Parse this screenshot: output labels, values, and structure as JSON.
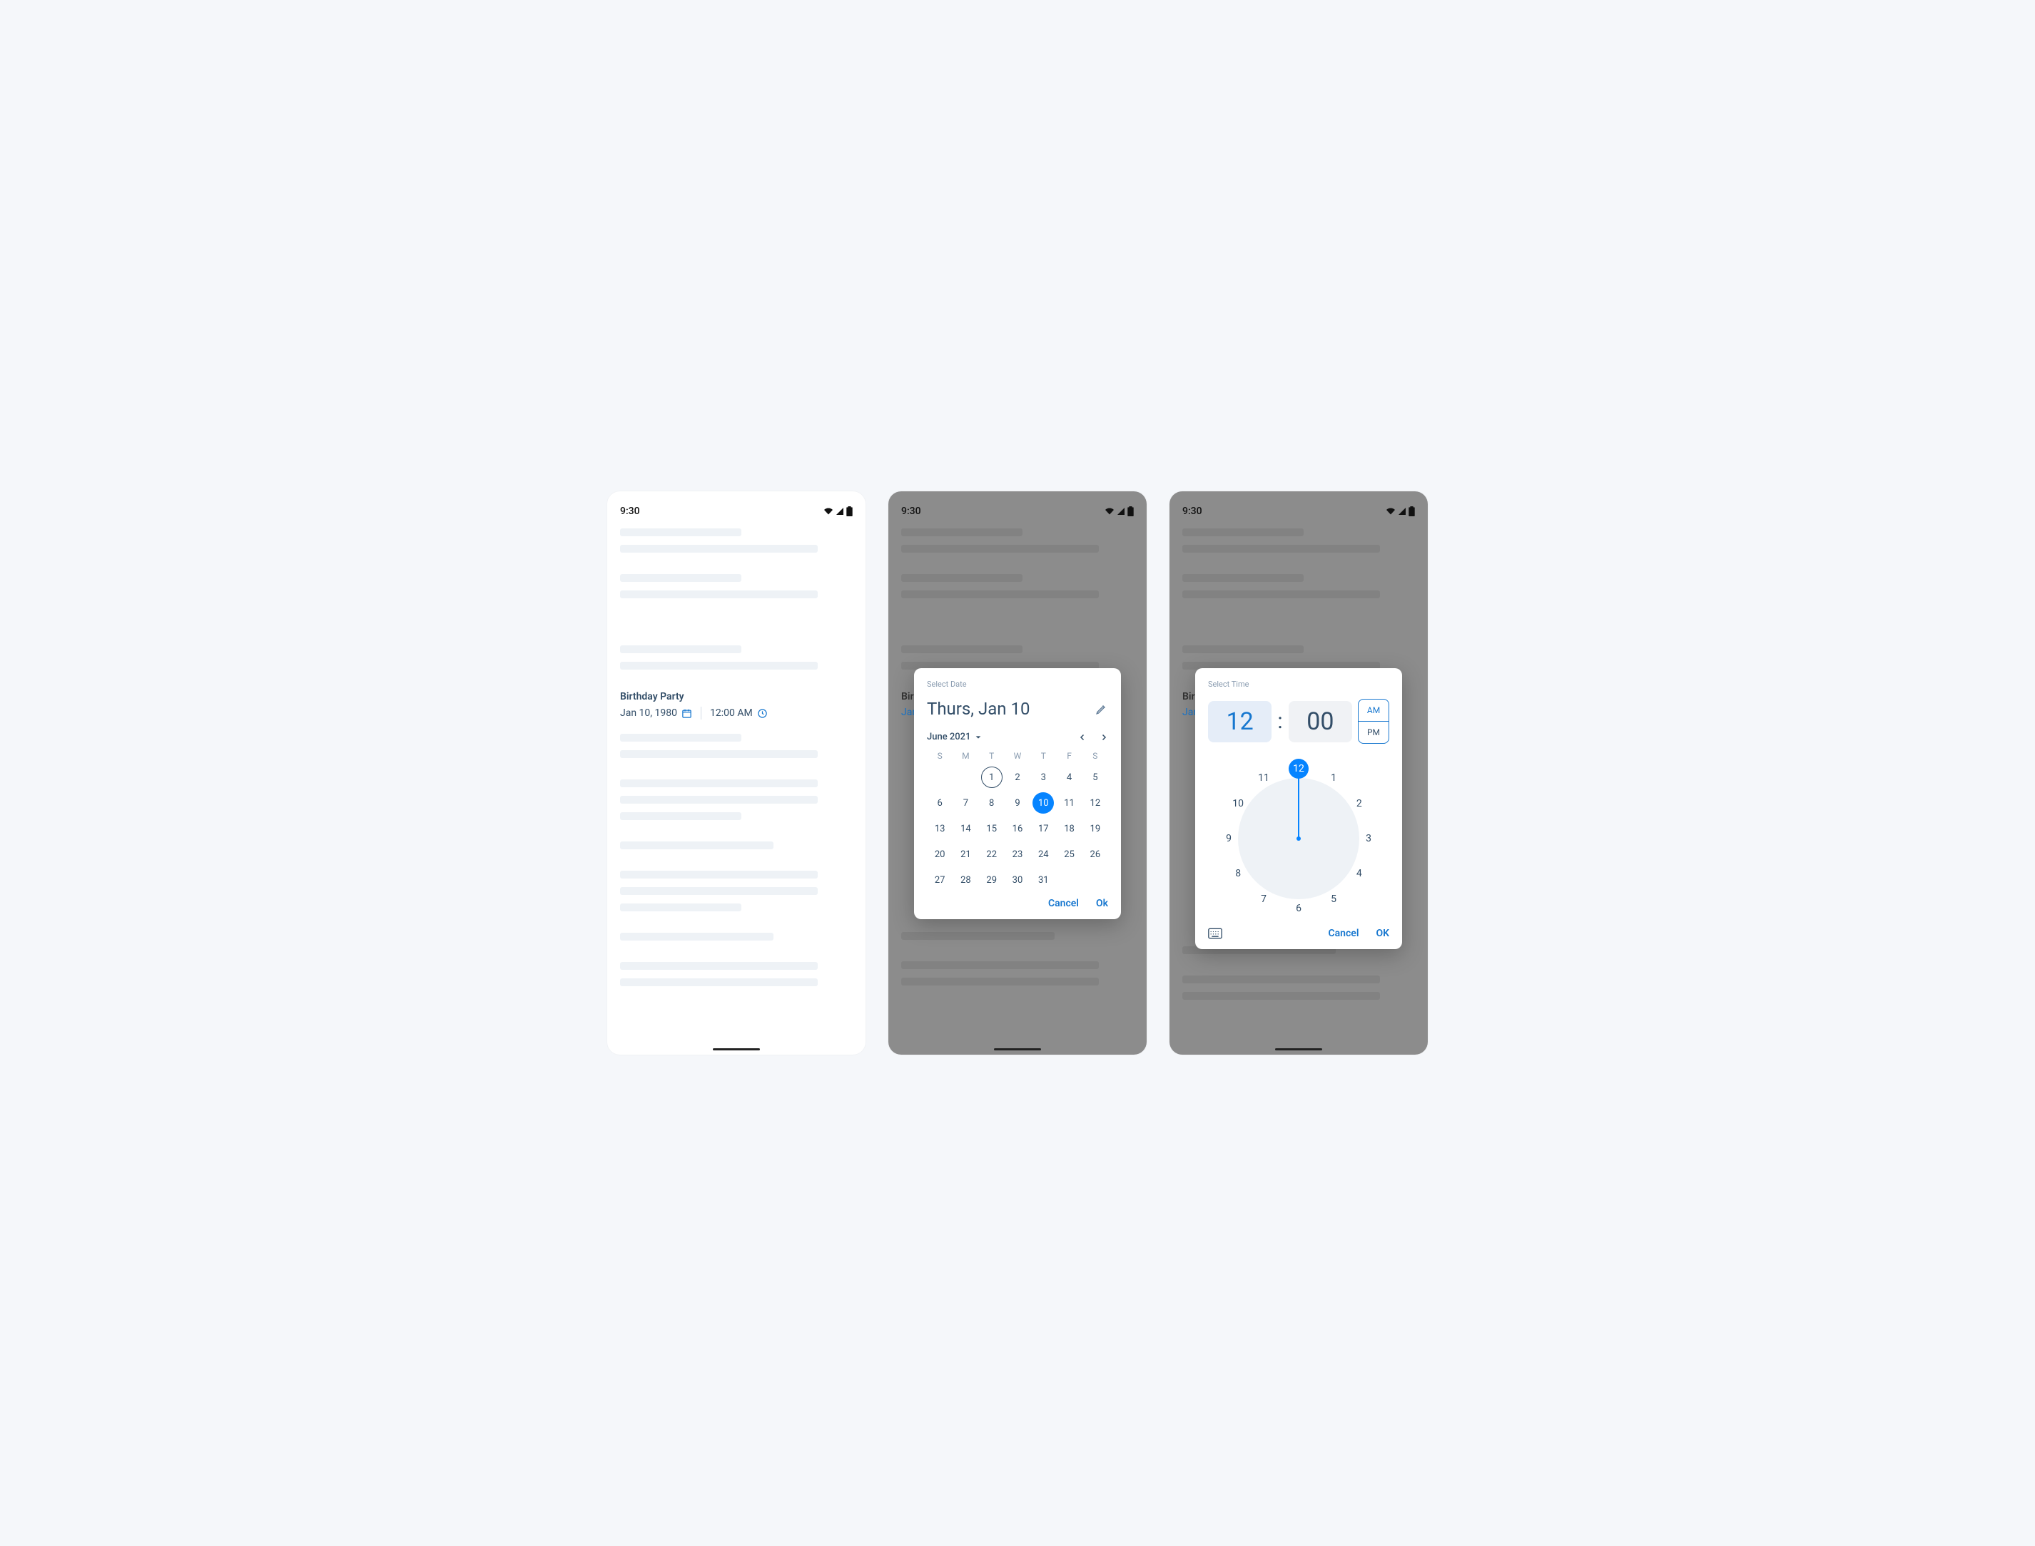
{
  "statusbar": {
    "time": "9:30"
  },
  "screen1": {
    "event_label": "Birthday Party",
    "date_value": "Jan 10, 1980",
    "time_value": "12:00 AM"
  },
  "screen2": {
    "event_label": "Birt",
    "date_value": "Jan"
  },
  "screen3": {
    "event_label": "Birt",
    "date_value": "Jan"
  },
  "date_picker": {
    "eyebrow": "Select Date",
    "headline": "Thurs, Jan 10",
    "month_label": "June 2021",
    "dow": [
      "S",
      "M",
      "T",
      "W",
      "T",
      "F",
      "S"
    ],
    "rows": [
      [
        "",
        "1",
        "2",
        "3",
        "4",
        "5"
      ],
      [
        "6",
        "7",
        "8",
        "9",
        "10",
        "11",
        "12"
      ],
      [
        "13",
        "14",
        "15",
        "16",
        "17",
        "18",
        "19"
      ],
      [
        "20",
        "21",
        "22",
        "23",
        "24",
        "25",
        "26"
      ],
      [
        "27",
        "28",
        "29",
        "30",
        "31",
        "",
        ""
      ]
    ],
    "today": "1",
    "selected": "10",
    "cancel": "Cancel",
    "ok": "Ok"
  },
  "time_picker": {
    "eyebrow": "Select Time",
    "hour": "12",
    "minute": "00",
    "am": "AM",
    "pm": "PM",
    "selected_ampm": "AM",
    "clock_numbers": [
      "12",
      "1",
      "2",
      "3",
      "4",
      "5",
      "6",
      "7",
      "8",
      "9",
      "10",
      "11"
    ],
    "selected_num": "12",
    "cancel": "Cancel",
    "ok": "OK"
  }
}
